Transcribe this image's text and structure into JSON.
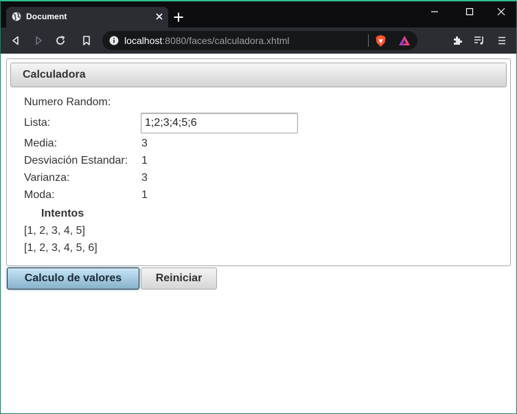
{
  "browser": {
    "tab_title": "Document",
    "url_host": "localhost",
    "url_rest": ":8080/faces/calculadora.xhtml",
    "accent_color": "#2fbf8f",
    "icons": {
      "favicon": "globe-icon",
      "close": "close-icon",
      "new_tab": "plus-icon",
      "back": "back-arrow-icon",
      "forward": "forward-arrow-icon",
      "reload": "reload-icon",
      "bookmark": "bookmark-icon",
      "site_info": "info-icon",
      "shields": "brave-shields-icon",
      "rewards": "brave-rewards-icon",
      "extensions": "puzzle-icon",
      "playlist": "playlist-icon",
      "menu": "hamburger-menu-icon"
    }
  },
  "panel": {
    "title": "Calculadora"
  },
  "fields": {
    "numero_random": {
      "label": "Numero Random:",
      "value": ""
    },
    "lista": {
      "label": "Lista:",
      "value": "1;2;3;4;5;6"
    },
    "media": {
      "label": "Media:",
      "value": "3"
    },
    "desviacion": {
      "label": "Desviación Estandar:",
      "value": "1"
    },
    "varianza": {
      "label": "Varianza:",
      "value": "3"
    },
    "moda": {
      "label": "Moda:",
      "value": "1"
    }
  },
  "attempts": {
    "heading": "Intentos",
    "items": [
      "[1, 2, 3, 4, 5]",
      "[1, 2, 3, 4, 5, 6]"
    ]
  },
  "buttons": {
    "calculate": "Calculo de valores",
    "reset": "Reiniciar"
  }
}
